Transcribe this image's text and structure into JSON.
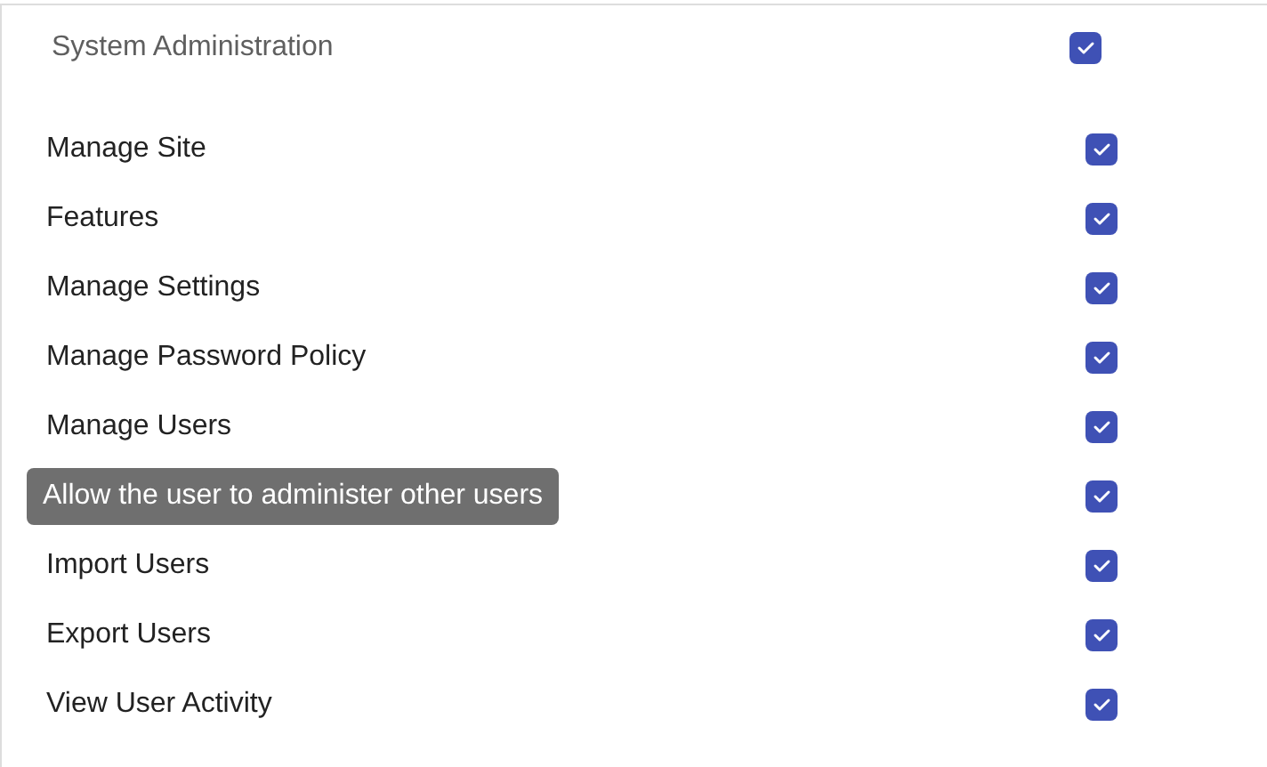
{
  "section": {
    "title": "System Administration",
    "checked": true
  },
  "permissions": [
    {
      "label": "Manage Site",
      "checked": true
    },
    {
      "label": "Features",
      "checked": true
    },
    {
      "label": "Manage Settings",
      "checked": true
    },
    {
      "label": "Manage Password Policy",
      "checked": true
    },
    {
      "label": "Manage Users",
      "checked": true
    },
    {
      "checked": true,
      "tooltip": "Allow the user to administer other users"
    },
    {
      "label": "Import Users",
      "checked": true
    },
    {
      "label": "Export Users",
      "checked": true
    },
    {
      "label": "View User Activity",
      "checked": true
    }
  ]
}
